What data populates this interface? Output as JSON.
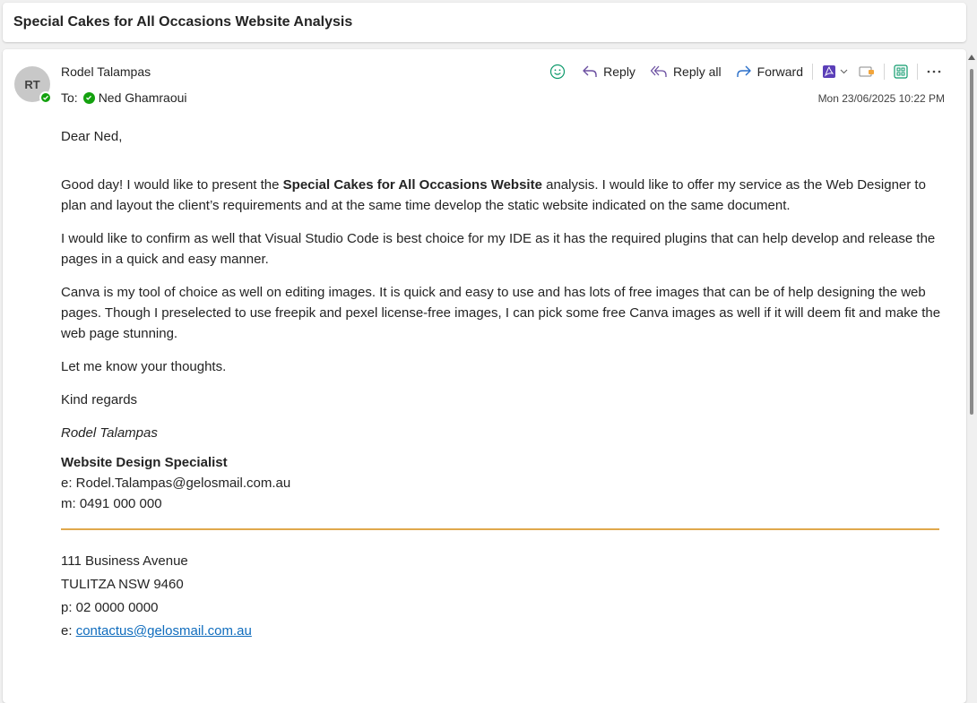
{
  "subject": "Special Cakes for All Occasions Website Analysis",
  "sender": {
    "initials": "RT",
    "name": "Rodel Talampas"
  },
  "recipient": {
    "to_label": "To:",
    "name": "Ned Ghamraoui"
  },
  "toolbar": {
    "reply": "Reply",
    "reply_all": "Reply all",
    "forward": "Forward"
  },
  "timestamp": "Mon 23/06/2025 10:22 PM",
  "body": {
    "greeting": "Dear Ned,",
    "p1_before": "Good day! I would like to present the ",
    "p1_bold": "Special Cakes for All Occasions Website",
    "p1_after": " analysis. I would like to offer my service as the Web Designer to plan and layout the client’s requirements and at the same time develop the static website indicated on the same document.",
    "p2": "I would like to confirm as well that Visual Studio Code is best choice for my IDE as it has the required plugins that can help develop and release the pages in a quick and easy manner.",
    "p3": "Canva is my tool of choice as well on editing images. It is quick and easy to use and has lots of free images that can be of help designing the web pages. Though I preselected to use freepik and pexel license-free images, I can pick some free Canva images as well if it will deem fit and make the web page stunning.",
    "p4": "Let me know your thoughts.",
    "closing": "Kind regards"
  },
  "signature": {
    "name": "Rodel Talampas",
    "title": "Website Design Specialist",
    "email": "e: Rodel.Talampas@gelosmail.com.au",
    "mobile": "m: 0491 000 000",
    "address_line1": "111 Business Avenue",
    "address_line2": "TULITZA NSW 9460",
    "phone": "p: 02 0000 0000",
    "contact_prefix": "e: ",
    "contact_email": "contactus@gelosmail.com.au"
  },
  "colors": {
    "accent_blue": "#0f6cbd",
    "presence_green": "#13a10e",
    "divider_gold": "#e0a84c",
    "reply_purple": "#6b4fa0"
  }
}
